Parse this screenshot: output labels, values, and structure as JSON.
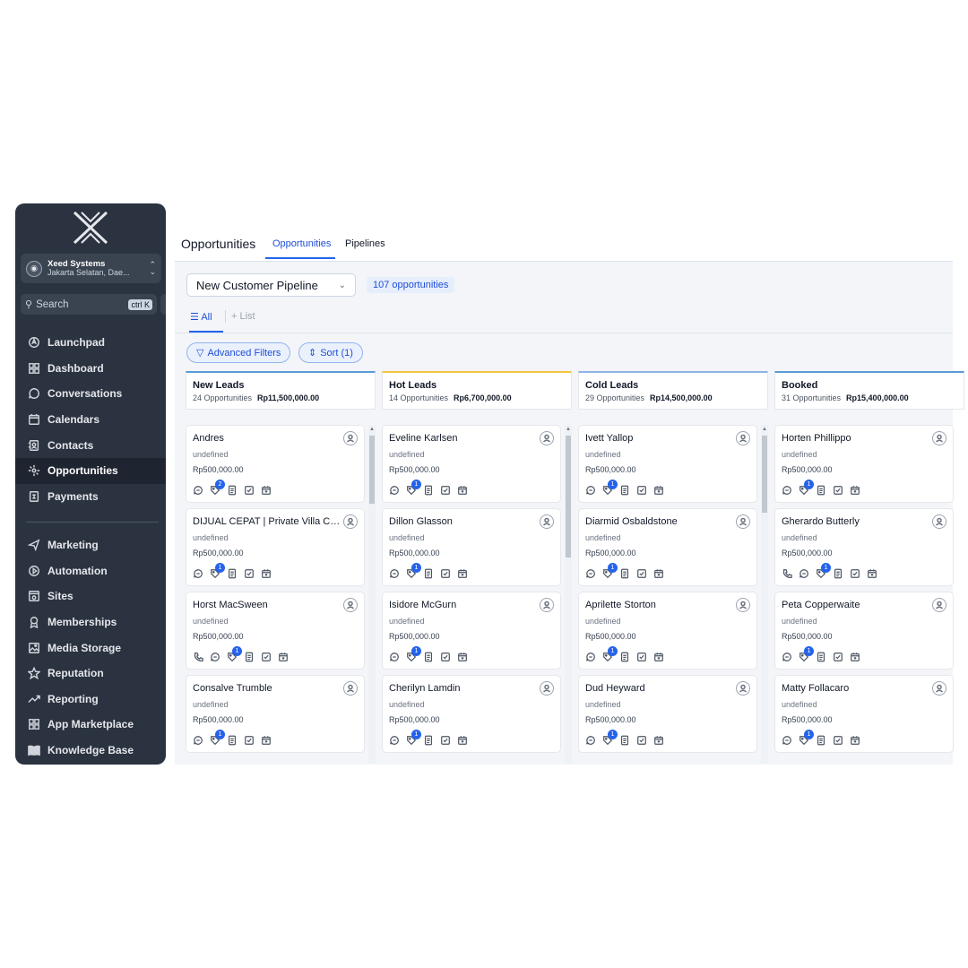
{
  "sidebar": {
    "account_name": "Xeed Systems",
    "account_location": "Jakarta Selatan, Dae...",
    "search_placeholder": "Search",
    "search_shortcut": "ctrl K",
    "nav": [
      {
        "label": "Launchpad",
        "icon": "rocket-icon"
      },
      {
        "label": "Dashboard",
        "icon": "grid-icon"
      },
      {
        "label": "Conversations",
        "icon": "chat-icon"
      },
      {
        "label": "Calendars",
        "icon": "calendar-icon"
      },
      {
        "label": "Contacts",
        "icon": "contacts-icon"
      },
      {
        "label": "Opportunities",
        "icon": "funnel-icon",
        "active": true
      },
      {
        "label": "Payments",
        "icon": "payments-icon"
      }
    ],
    "nav2": [
      {
        "label": "Marketing",
        "icon": "send-icon"
      },
      {
        "label": "Automation",
        "icon": "automation-icon"
      },
      {
        "label": "Sites",
        "icon": "sites-icon"
      },
      {
        "label": "Memberships",
        "icon": "badge-icon"
      },
      {
        "label": "Media Storage",
        "icon": "image-icon"
      },
      {
        "label": "Reputation",
        "icon": "star-icon"
      },
      {
        "label": "Reporting",
        "icon": "trend-icon"
      },
      {
        "label": "App Marketplace",
        "icon": "apps-icon"
      },
      {
        "label": "Knowledge Base",
        "icon": "book-icon"
      }
    ]
  },
  "header": {
    "title": "Opportunities",
    "tabs": [
      "Opportunities",
      "Pipelines"
    ]
  },
  "toolbar": {
    "pipeline": "New Customer Pipeline",
    "count": "107 opportunities",
    "view_all": "All",
    "view_list": "List",
    "advanced_filters": "Advanced Filters",
    "sort": "Sort (1)"
  },
  "colors": {
    "new": "#5b9bd5",
    "hot": "#f4c542",
    "cold": "#8fb3e8",
    "booked": "#5b9bd5",
    "badge": "#2563eb"
  },
  "columns": [
    {
      "title": "New Leads",
      "count": "24 Opportunities",
      "value": "Rp11,500,000.00",
      "cards": [
        {
          "name": "Andres",
          "sub": "undefined",
          "value": "Rp500,000.00",
          "badge": "2",
          "phone": false
        },
        {
          "name": "DIJUAL CEPAT | Private Villa Cij...",
          "sub": "undefined",
          "value": "Rp500,000.00",
          "badge": "1",
          "phone": false
        },
        {
          "name": "Horst MacSween",
          "sub": "undefined",
          "value": "Rp500,000.00",
          "badge": "1",
          "phone": true
        },
        {
          "name": "Consalve Trumble",
          "sub": "undefined",
          "value": "Rp500,000.00",
          "badge": "1",
          "phone": false
        }
      ]
    },
    {
      "title": "Hot Leads",
      "count": "14 Opportunities",
      "value": "Rp6,700,000.00",
      "cards": [
        {
          "name": "Eveline Karlsen",
          "sub": "undefined",
          "value": "Rp500,000.00",
          "badge": "1",
          "phone": false
        },
        {
          "name": "Dillon Glasson",
          "sub": "undefined",
          "value": "Rp500,000.00",
          "badge": "1",
          "phone": false
        },
        {
          "name": "Isidore McGurn",
          "sub": "undefined",
          "value": "Rp500,000.00",
          "badge": "1",
          "phone": false
        },
        {
          "name": "Cherilyn Lamdin",
          "sub": "undefined",
          "value": "Rp500,000.00",
          "badge": "1",
          "phone": false
        }
      ]
    },
    {
      "title": "Cold Leads",
      "count": "29 Opportunities",
      "value": "Rp14,500,000.00",
      "cards": [
        {
          "name": "Ivett Yallop",
          "sub": "undefined",
          "value": "Rp500,000.00",
          "badge": "1",
          "phone": false
        },
        {
          "name": "Diarmid Osbaldstone",
          "sub": "undefined",
          "value": "Rp500,000.00",
          "badge": "1",
          "phone": false
        },
        {
          "name": "Aprilette Storton",
          "sub": "undefined",
          "value": "Rp500,000.00",
          "badge": "1",
          "phone": false
        },
        {
          "name": "Dud Heyward",
          "sub": "undefined",
          "value": "Rp500,000.00",
          "badge": "1",
          "phone": false
        }
      ]
    },
    {
      "title": "Booked",
      "count": "31 Opportunities",
      "value": "Rp15,400,000.00",
      "cards": [
        {
          "name": "Horten Phillippo",
          "sub": "undefined",
          "value": "Rp500,000.00",
          "badge": "1",
          "phone": false
        },
        {
          "name": "Gherardo Butterly",
          "sub": "undefined",
          "value": "Rp500,000.00",
          "badge": "1",
          "phone": true
        },
        {
          "name": "Peta Copperwaite",
          "sub": "undefined",
          "value": "Rp500,000.00",
          "badge": "1",
          "phone": false
        },
        {
          "name": "Matty Follacaro",
          "sub": "undefined",
          "value": "Rp500,000.00",
          "badge": "1",
          "phone": false
        }
      ]
    }
  ]
}
